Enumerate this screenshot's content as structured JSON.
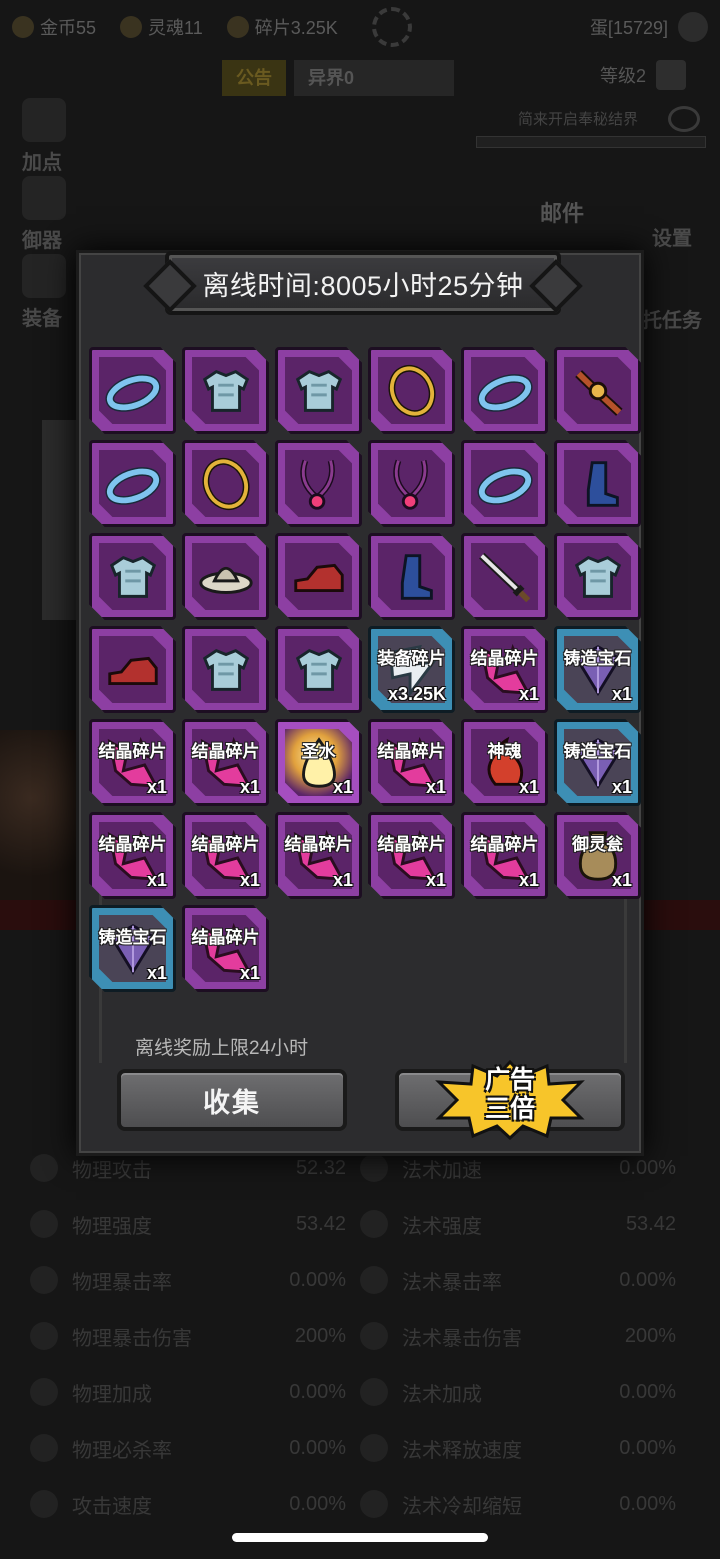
{
  "background": {
    "topbar": {
      "gold": "金币55",
      "soul": "灵魂11",
      "shard": "碎片3.25K",
      "egg": "蛋[15729]"
    },
    "tabs": {
      "notice": "公告",
      "world": "异界0"
    },
    "level": "等级2",
    "unlock_hint": "简来开启奉秘结界",
    "left_menu": [
      "加点",
      "御器",
      "装备"
    ],
    "right_menu": {
      "mail": "邮件",
      "settings": "设置",
      "task": "托任务"
    },
    "stats": [
      [
        "物理攻击",
        "52.32",
        "法术加速",
        "0.00%"
      ],
      [
        "物理强度",
        "53.42",
        "法术强度",
        "53.42"
      ],
      [
        "物理暴击率",
        "0.00%",
        "法术暴击率",
        "0.00%"
      ],
      [
        "物理暴击伤害",
        "200%",
        "法术暴击伤害",
        "200%"
      ],
      [
        "物理加成",
        "0.00%",
        "法术加成",
        "0.00%"
      ],
      [
        "物理必杀率",
        "0.00%",
        "法术释放速度",
        "0.00%"
      ],
      [
        "攻击速度",
        "0.00%",
        "法术冷却缩短",
        "0.00%"
      ]
    ]
  },
  "modal": {
    "title": "离线时间:8005小时25分钟",
    "limit_text": "离线奖励上限24小时",
    "collect_label": "收集",
    "ad_label_line1": "广告",
    "ad_label_line2": "三倍",
    "items": [
      {
        "icon": "bracelet-icon",
        "frame": "purple"
      },
      {
        "icon": "armor-icon",
        "frame": "purple"
      },
      {
        "icon": "armor-icon",
        "frame": "purple"
      },
      {
        "icon": "gold-ring-icon",
        "frame": "purple"
      },
      {
        "icon": "bracelet-icon",
        "frame": "purple"
      },
      {
        "icon": "belt-icon",
        "frame": "purple"
      },
      {
        "icon": "bracelet-icon",
        "frame": "purple"
      },
      {
        "icon": "gold-ring-icon",
        "frame": "purple"
      },
      {
        "icon": "necklace-icon",
        "frame": "purple"
      },
      {
        "icon": "necklace-icon",
        "frame": "purple"
      },
      {
        "icon": "bracelet-icon",
        "frame": "purple"
      },
      {
        "icon": "boot-icon",
        "frame": "purple"
      },
      {
        "icon": "armor-icon",
        "frame": "purple"
      },
      {
        "icon": "hat-icon",
        "frame": "purple"
      },
      {
        "icon": "red-shoe-icon",
        "frame": "purple"
      },
      {
        "icon": "boot-icon",
        "frame": "purple"
      },
      {
        "icon": "sword-icon",
        "frame": "purple"
      },
      {
        "icon": "armor-icon",
        "frame": "purple"
      },
      {
        "icon": "red-shoe-icon",
        "frame": "purple"
      },
      {
        "icon": "armor-icon",
        "frame": "purple"
      },
      {
        "icon": "armor-icon",
        "frame": "purple"
      },
      {
        "icon": "equipment-shard-icon",
        "frame": "blue",
        "name": "装备碎片",
        "count": "x3.25K"
      },
      {
        "icon": "crystal-shard-icon",
        "frame": "purple",
        "name": "结晶碎片",
        "count": "x1"
      },
      {
        "icon": "forge-gem-icon",
        "frame": "blue",
        "name": "铸造宝石",
        "count": "x1"
      },
      {
        "icon": "crystal-shard-icon",
        "frame": "purple",
        "name": "结晶碎片",
        "count": "x1"
      },
      {
        "icon": "crystal-shard-icon",
        "frame": "purple",
        "name": "结晶碎片",
        "count": "x1"
      },
      {
        "icon": "holy-water-icon",
        "frame": "gold",
        "name": "圣水",
        "count": "x1"
      },
      {
        "icon": "crystal-shard-icon",
        "frame": "purple",
        "name": "结晶碎片",
        "count": "x1"
      },
      {
        "icon": "divine-soul-icon",
        "frame": "purple",
        "name": "神魂",
        "count": "x1"
      },
      {
        "icon": "forge-gem-icon",
        "frame": "blue",
        "name": "铸造宝石",
        "count": "x1"
      },
      {
        "icon": "crystal-shard-icon",
        "frame": "purple",
        "name": "结晶碎片",
        "count": "x1"
      },
      {
        "icon": "crystal-shard-icon",
        "frame": "purple",
        "name": "结晶碎片",
        "count": "x1"
      },
      {
        "icon": "crystal-shard-icon",
        "frame": "purple",
        "name": "结晶碎片",
        "count": "x1"
      },
      {
        "icon": "crystal-shard-icon",
        "frame": "purple",
        "name": "结晶碎片",
        "count": "x1"
      },
      {
        "icon": "crystal-shard-icon",
        "frame": "purple",
        "name": "结晶碎片",
        "count": "x1"
      },
      {
        "icon": "spirit-jar-icon",
        "frame": "purple",
        "name": "御灵瓮",
        "count": "x1"
      },
      {
        "icon": "forge-gem-icon",
        "frame": "blue",
        "name": "铸造宝石",
        "count": "x1"
      },
      {
        "icon": "crystal-shard-icon",
        "frame": "purple",
        "name": "结晶碎片",
        "count": "x1"
      }
    ]
  }
}
